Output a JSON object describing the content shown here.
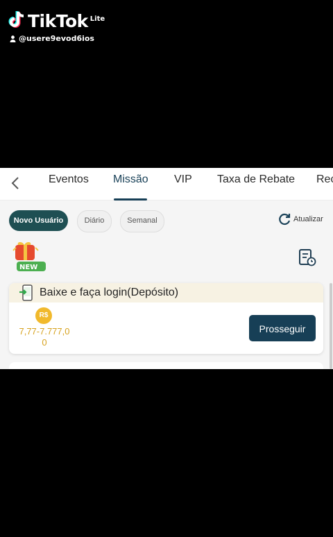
{
  "watermark": {
    "brand": "TikTok",
    "suffix": "Lite",
    "username": "@usere9evod6ios"
  },
  "tabs": [
    {
      "label": "Eventos"
    },
    {
      "label": "Missão"
    },
    {
      "label": "VIP"
    },
    {
      "label": "Taxa de Rebate"
    },
    {
      "label": "Rec"
    }
  ],
  "active_tab": "Missão",
  "filters": [
    {
      "label": "Novo Usuário"
    },
    {
      "label": "Diário"
    },
    {
      "label": "Semanal"
    }
  ],
  "refresh_label": "Atualizar",
  "badge_label": "NEW",
  "task": {
    "title": "Baixe e faça login(Depósito)",
    "coin_label": "R$",
    "reward": "7,77-7.777,00",
    "button_label": "Prosseguir"
  },
  "colors": {
    "primary": "#173f56",
    "chip_active": "#1e4f53",
    "gold": "#d7a21e",
    "header_bg": "#f7f2e3"
  }
}
